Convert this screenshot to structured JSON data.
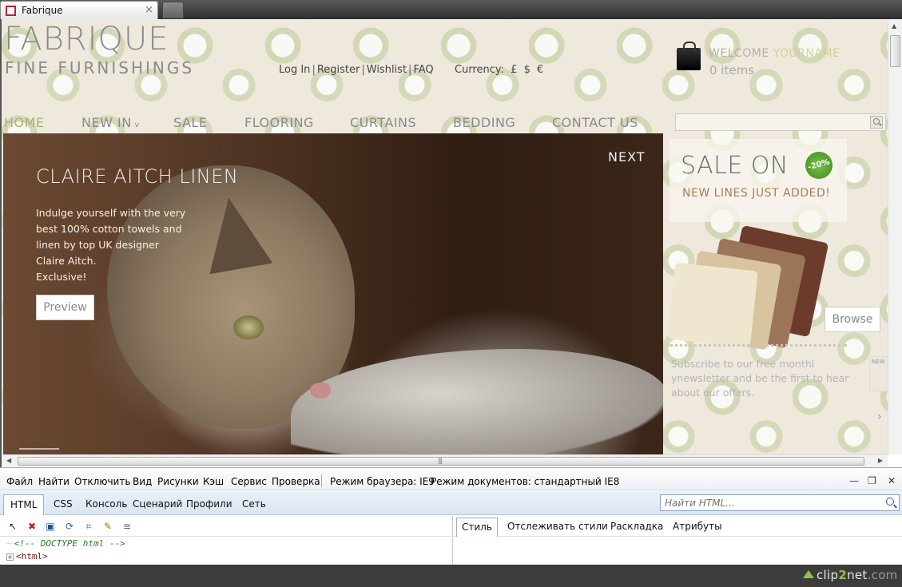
{
  "browser": {
    "tab_title": "Fabrique",
    "tab_close": "×"
  },
  "site": {
    "logo_main": "FABRIQUE",
    "logo_sub": "FINE FURNISHINGS",
    "toplinks": [
      "Log In",
      "Register",
      "Wishlist",
      "FAQ"
    ],
    "currency_label": "Currency:",
    "currencies": [
      "£",
      "$",
      "€"
    ],
    "welcome_prefix": "WELCOME",
    "welcome_name": "YOURNAME",
    "cart_items": "0 items",
    "nav": [
      {
        "label": "HOME",
        "active": true
      },
      {
        "label": "NEW IN",
        "caret": "v"
      },
      {
        "label": "SALE"
      },
      {
        "label": "FLOORING"
      },
      {
        "label": "CURTAINS"
      },
      {
        "label": "BEDDING"
      },
      {
        "label": "CONTACT US"
      }
    ],
    "hero": {
      "title": "CLAIRE AITCH LINEN",
      "text_lines": [
        "Indulge yourself with the very",
        "best 100% cotton towels and",
        "linen by top UK designer",
        "Claire Aitch.",
        "Exclusive!"
      ],
      "preview_label": "Preview",
      "next_label": "NEXT"
    },
    "sale": {
      "title": "SALE ON",
      "badge": "-20%",
      "subtitle": "NEW LINES JUST ADDED!",
      "browse_label": "Browse"
    },
    "newsletter_lines": [
      "Subscribe to our free monthl",
      "ynewsletter and be the first to hear",
      "about our offers."
    ],
    "newsletter_peek": "NEW"
  },
  "devtools": {
    "menu": [
      "Файл",
      "Найти",
      "Отключить",
      "Вид",
      "Рисунки",
      "Кэш",
      "Сервис",
      "Проверка"
    ],
    "browser_mode": "Режим браузера: IE9",
    "document_mode": "Режим документов: стандартный IE8",
    "tabs": [
      "HTML",
      "CSS",
      "Консоль",
      "Сценарий",
      "Профили",
      "Сеть"
    ],
    "search_placeholder": "Найти HTML...",
    "right_tabs": [
      "Стиль",
      "Отслеживать стили",
      "Раскладка",
      "Атрибуты"
    ],
    "tree": [
      "<!-- DOCTYPE html -->",
      "<html>"
    ]
  },
  "watermark": {
    "prefix": "clip",
    "two": "2",
    "suffix": "net",
    "domain": ".com"
  },
  "colors": {
    "nav_active": "#a8b36a",
    "sale_badge": "#4fa42a",
    "sale_subtitle": "#a97c5c"
  }
}
